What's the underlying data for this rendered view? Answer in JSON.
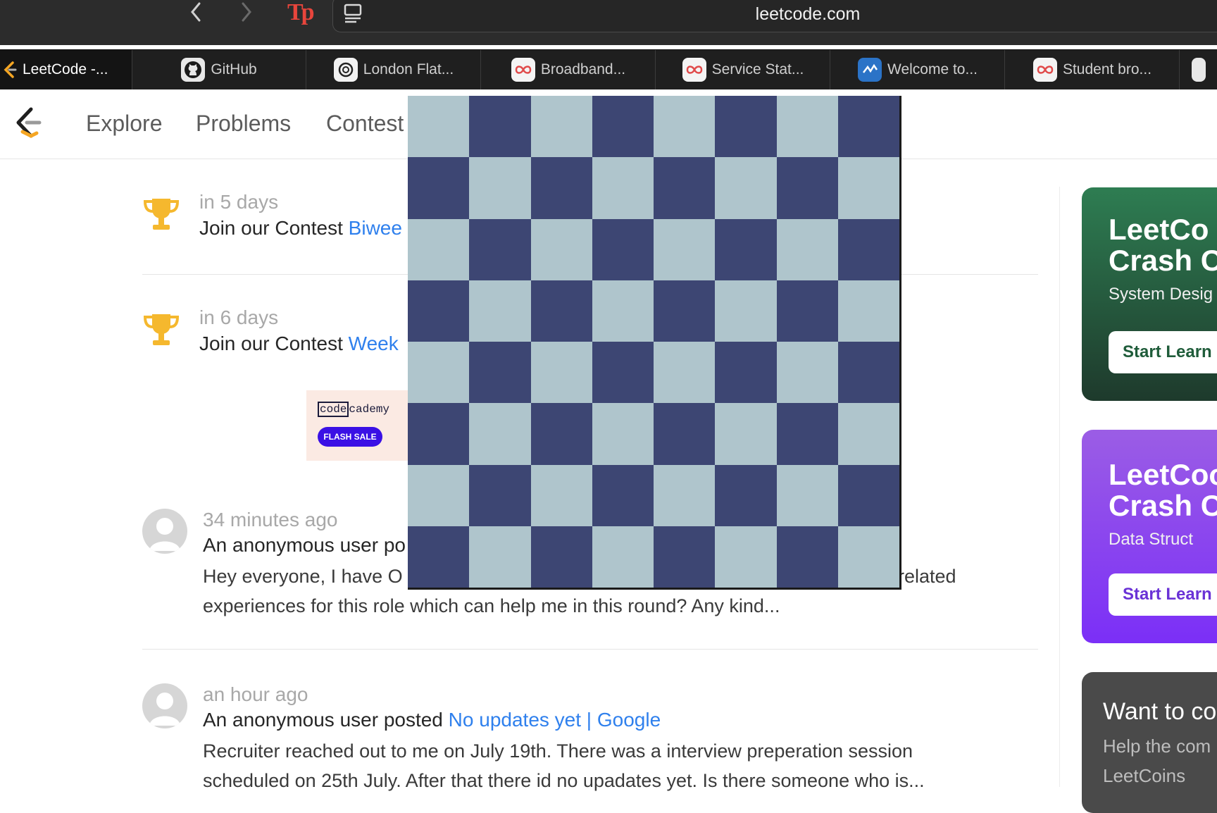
{
  "browser": {
    "url": "leetcode.com",
    "extension_icon": "Tp",
    "tabs": [
      {
        "label": "LeetCode -...",
        "icon": "leetcode-icon",
        "active": true
      },
      {
        "label": "GitHub",
        "icon": "github-icon"
      },
      {
        "label": "London Flat...",
        "icon": "openai-icon"
      },
      {
        "label": "Broadband...",
        "icon": "infinity-icon"
      },
      {
        "label": "Service Stat...",
        "icon": "infinity-icon"
      },
      {
        "label": "Welcome to...",
        "icon": "welcome-icon"
      },
      {
        "label": "Student bro...",
        "icon": "infinity-icon"
      }
    ]
  },
  "site": {
    "nav": [
      "Explore",
      "Problems",
      "Contest"
    ]
  },
  "feed": [
    {
      "type": "contest",
      "time": "in 5 days",
      "prefix": "Join our Contest ",
      "link": "Biwee"
    },
    {
      "type": "contest",
      "time": "in 6 days",
      "prefix": "Join our Contest ",
      "link": "Week"
    },
    {
      "type": "post",
      "time": "34 minutes ago",
      "prefix": "An anonymous user po",
      "link": "",
      "excerpt_line1": "Hey everyone, I have O",
      "excerpt_line1_tail": "related",
      "excerpt_line2": "experiences for this role which can help me in this round? Any kind..."
    },
    {
      "type": "post",
      "time": "an hour ago",
      "prefix": "An anonymous user posted ",
      "link": "No updates yet | Google",
      "excerpt_line1": "Recruiter reached out to me on July 19th. There was a interview preperation session",
      "excerpt_line2": "scheduled on 25th July. After that there id no upadates yet. Is there someone who is..."
    }
  ],
  "ad": {
    "logo_code": "code",
    "logo_rest": "cademy",
    "badge": "FLASH SALE"
  },
  "cards": [
    {
      "title1": "LeetCo",
      "title2": "Crash C",
      "subtitle": "System Desig",
      "button": "Start Learn",
      "color_top": "#2e7d52",
      "color_bottom": "#1e3a2c",
      "button_color": "#1f5c3a"
    },
    {
      "title1": "LeetCoo",
      "title2": "Crash C",
      "subtitle": "Data Struct",
      "button": "Start Learn",
      "color_top": "#9b5de5",
      "color_bottom": "#7b2ff7",
      "button_color": "#6a32d6"
    },
    {
      "title1": "Want to co",
      "subtitle1": "Help the com",
      "subtitle2": "LeetCoins"
    }
  ],
  "colors": {
    "board_light": "#afc5cc",
    "board_dark": "#3d4673",
    "link": "#2f80ed"
  }
}
